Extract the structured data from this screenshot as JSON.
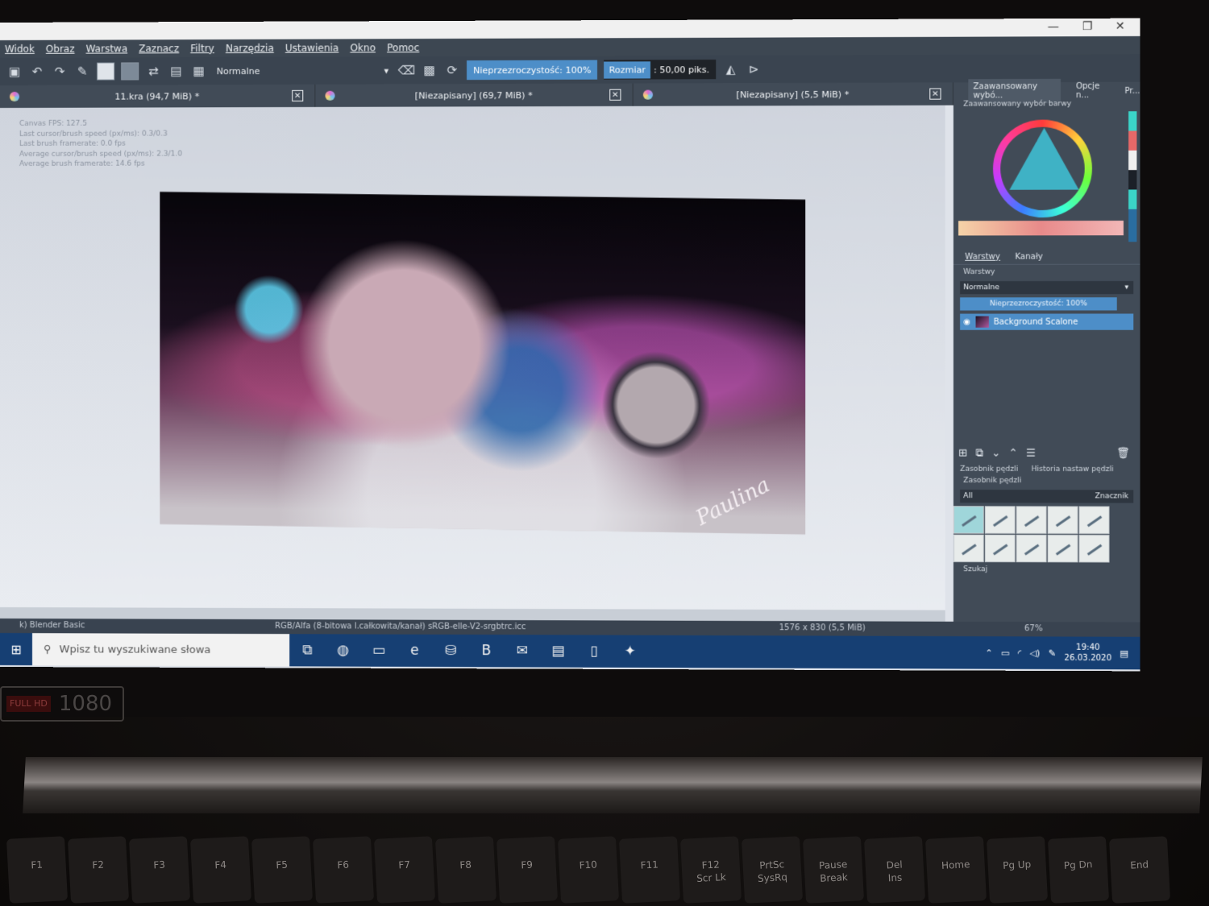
{
  "menu": [
    "Widok",
    "Obraz",
    "Warstwa",
    "Zaznacz",
    "Filtry",
    "Narzędzia",
    "Ustawienia",
    "Okno",
    "Pomoc"
  ],
  "toolbar": {
    "blend_mode": "Normalne",
    "opacity_label": "Nieprzezroczystość: 100%",
    "size_label_prefix": "Rozmiar",
    "size_label_value": ": 50,00 piks."
  },
  "tabs": [
    {
      "title": "11.kra (94,7 MiB) *"
    },
    {
      "title": "[Niezapisany]  (69,7 MiB) *"
    },
    {
      "title": "[Niezapisany]  (5,5 MiB) *"
    }
  ],
  "canvas_overlay": [
    "Canvas FPS: 127.5",
    "Last cursor/brush speed (px/ms): 0.3/0.3",
    "Last brush framerate: 0.0 fps",
    "Average cursor/brush speed (px/ms): 2.3/1.0",
    "Average brush framerate: 14.6 fps"
  ],
  "statusbar": {
    "brush": "k) Blender Basic",
    "colorspace": "RGB/Alfa (8-bitowa l.całkowita/kanał)  sRGB-elle-V2-srgbtrc.icc",
    "dimensions": "1576 x 830 (5,5 MiB)",
    "zoom": "67%"
  },
  "dock": {
    "tabs": [
      "Zaawansowany wybó...",
      "Opcje n...",
      "Pr..."
    ],
    "color_selector_title": "Zaawansowany wybór barwy",
    "layers_tabs": [
      "Warstwy",
      "Kanały"
    ],
    "layers_title": "Warstwy",
    "layers_blend": "Normalne",
    "layers_opacity": "Nieprzezroczystość:  100%",
    "layer_name": "Background Scalone",
    "brush_tabs": [
      "Zasobnik pędzli",
      "Historia nastaw pędzli"
    ],
    "brush_title": "Zasobnik pędzli",
    "brush_filter": "All",
    "brush_tag": "Znacznik",
    "brush_search": "Szukaj"
  },
  "taskbar": {
    "search_placeholder": "Wpisz tu wyszukiwane słowa",
    "time": "19:40",
    "date": "26.03.2020"
  },
  "hardware": {
    "badge_small": "FULL HD",
    "badge_big": "1080",
    "keys": [
      "F1",
      "F2",
      "F3",
      "F4",
      "F5",
      "F6",
      "F7",
      "F8",
      "F9",
      "F10",
      "F11",
      "F12\nScr Lk",
      "PrtSc\nSysRq",
      "Pause\nBreak",
      "Del\nIns",
      "Home",
      "Pg Up",
      "Pg Dn",
      "End"
    ]
  }
}
